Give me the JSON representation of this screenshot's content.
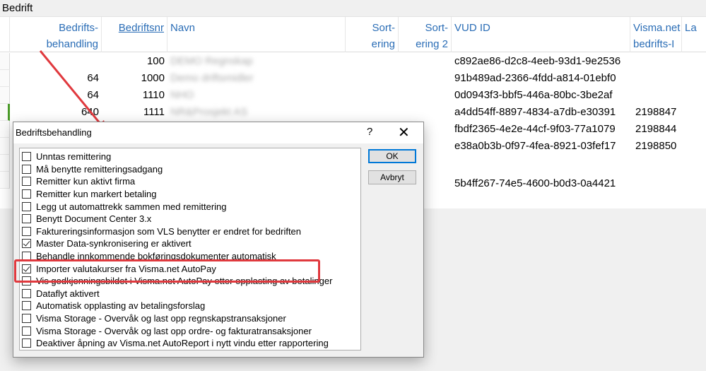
{
  "window": {
    "title": "Bedrift"
  },
  "grid": {
    "columns": [
      {
        "line1": "Bedrifts-",
        "line2": "behandling"
      },
      {
        "line1": "Bedriftsnr",
        "line2": ""
      },
      {
        "line1": "Navn",
        "line2": ""
      },
      {
        "line1": "Sort-",
        "line2": "ering"
      },
      {
        "line1": "Sort-",
        "line2": "ering 2"
      },
      {
        "line1": "VUD ID",
        "line2": ""
      },
      {
        "line1": "Visma.net",
        "line2": "bedrifts-I"
      },
      {
        "line1": "La",
        "line2": ""
      }
    ],
    "rows": [
      {
        "behandling": "",
        "bedriftsnr": "100",
        "navn": "DEMO Regnskap",
        "vud": "c892ae86-d2c8-4eeb-93d1-9e2536",
        "visma": ""
      },
      {
        "behandling": "64",
        "bedriftsnr": "1000",
        "navn": "Demo driftsmidler",
        "vud": "91b489ad-2366-4fdd-a814-01ebf0",
        "visma": ""
      },
      {
        "behandling": "64",
        "bedriftsnr": "1110",
        "navn": "NHO",
        "vud": "0d0943f3-bbf5-446a-80bc-3be2af",
        "visma": ""
      },
      {
        "behandling": "640",
        "bedriftsnr": "1111",
        "navn": "NR&Prosjekt AS",
        "vud": "a4dd54ff-8897-4834-a7db-e30391",
        "visma": "2198847"
      },
      {
        "behandling": "",
        "bedriftsnr": "",
        "navn": "",
        "vud": "fbdf2365-4e2e-44cf-9f03-77a1079",
        "visma": "2198844"
      },
      {
        "behandling": "",
        "bedriftsnr": "",
        "navn": "",
        "vud": "e38a0b3b-0f97-4fea-8921-03fef17",
        "visma": "2198850"
      },
      {
        "behandling": "",
        "bedriftsnr": "",
        "navn": "",
        "vud": "",
        "visma": ""
      },
      {
        "behandling": "",
        "bedriftsnr": "",
        "navn": "",
        "vud": "5b4ff267-74e5-4600-b0d3-0a4421",
        "visma": ""
      }
    ]
  },
  "dialog": {
    "title": "Bedriftsbehandling",
    "help": "?",
    "close": "✕",
    "ok_label": "OK",
    "cancel_label": "Avbryt",
    "options": [
      {
        "label": "Unntas remittering",
        "checked": false
      },
      {
        "label": "Må benytte remitteringsadgang",
        "checked": false
      },
      {
        "label": "Remitter kun aktivt firma",
        "checked": false
      },
      {
        "label": "Remitter kun markert betaling",
        "checked": false
      },
      {
        "label": "Legg ut automattrekk sammen med remittering",
        "checked": false
      },
      {
        "label": "Benytt Document Center 3.x",
        "checked": false
      },
      {
        "label": "Faktureringsinformasjon som VLS benytter er endret for bedriften",
        "checked": false
      },
      {
        "label": "Master Data-synkronisering er aktivert",
        "checked": true
      },
      {
        "label": "Behandle innkommende bokføringsdokumenter automatisk",
        "checked": false
      },
      {
        "label": "Importer valutakurser fra Visma.net AutoPay",
        "checked": true
      },
      {
        "label": "Vis godkjenningsbildet i Visma.net AutoPay etter opplasting av betalinger",
        "checked": false
      },
      {
        "label": "Dataflyt aktivert",
        "checked": false
      },
      {
        "label": "Automatisk opplasting av betalingsforslag",
        "checked": false
      },
      {
        "label": "Visma Storage - Overvåk og last opp regnskapstransaksjoner",
        "checked": false
      },
      {
        "label": "Visma Storage - Overvåk og last opp ordre- og fakturatransaksjoner",
        "checked": false
      },
      {
        "label": "Deaktiver åpning av Visma.net AutoReport i nytt vindu etter rapportering",
        "checked": false
      }
    ]
  },
  "annotation": {
    "color": "#e0393e"
  }
}
